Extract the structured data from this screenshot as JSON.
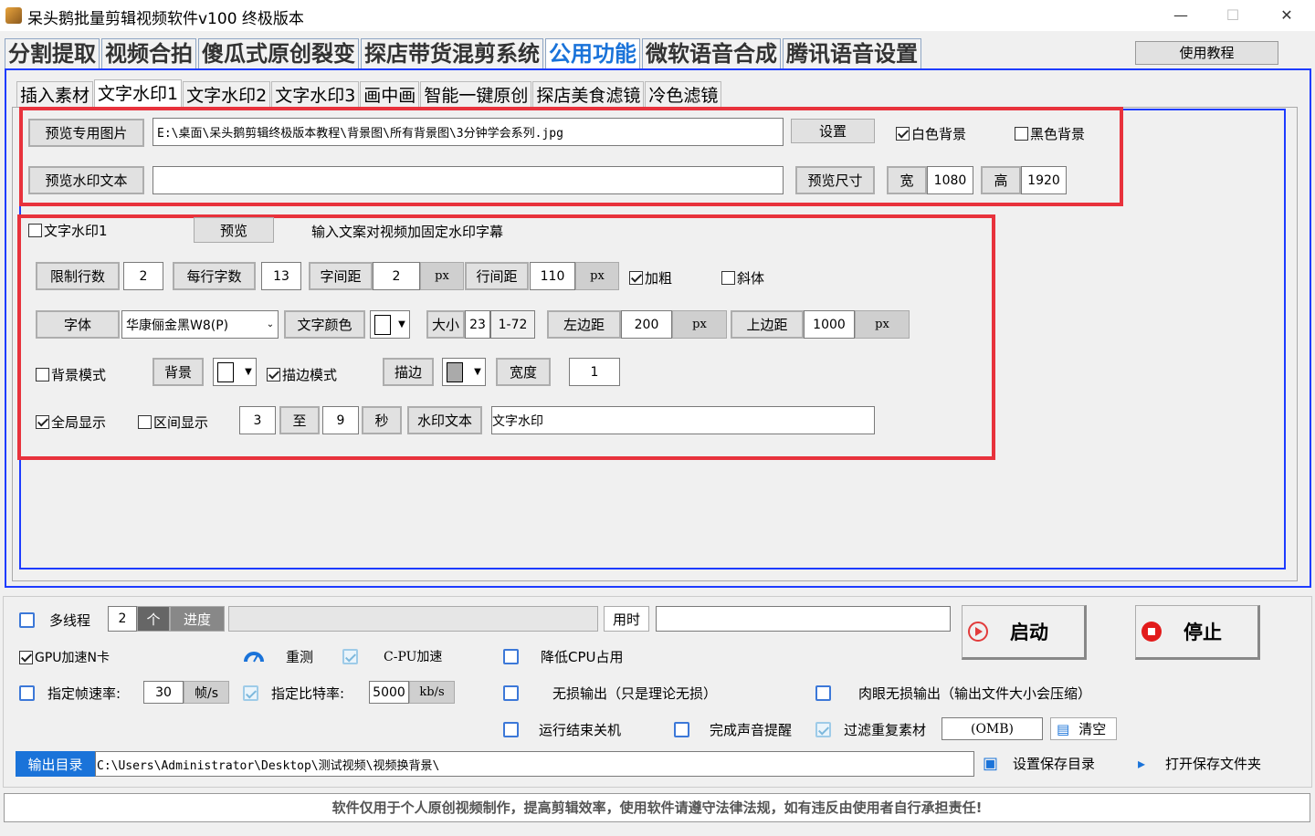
{
  "window": {
    "title": "呆头鹅批量剪辑视频软件v100 终极版本",
    "minimize": "—",
    "maximize": "☐",
    "close": "✕"
  },
  "main_tabs": [
    "分割提取",
    "视频合拍",
    "傻瓜式原创裂变",
    "探店带货混剪系统",
    "公用功能",
    "微软语音合成",
    "腾讯语音设置"
  ],
  "tutorial_button": "使用教程",
  "sub_tabs": [
    "插入素材",
    "文字水印1",
    "文字水印2",
    "文字水印3",
    "画中画",
    "智能一键原创",
    "探店美食滤镜",
    "冷色滤镜"
  ],
  "preview": {
    "image_button": "预览专用图片",
    "image_path": "E:\\桌面\\呆头鹅剪辑终极版本教程\\背景图\\所有背景图\\3分钟学会系列.jpg",
    "settings_button": "设置",
    "white_bg": "白色背景",
    "black_bg": "黑色背景",
    "watermark_text_button": "预览水印文本",
    "watermark_text_value": "",
    "size_button": "预览尺寸",
    "width_label": "宽",
    "width_value": "1080",
    "height_label": "高",
    "height_value": "1920"
  },
  "watermark": {
    "enable_label": "文字水印1",
    "preview_button": "预览",
    "description": "输入文案对视频加固定水印字幕",
    "limit_lines_label": "限制行数",
    "limit_lines_value": "2",
    "chars_per_line_label": "每行字数",
    "chars_per_line_value": "13",
    "char_spacing_label": "字间距",
    "char_spacing_value": "2",
    "px": "px",
    "line_spacing_label": "行间距",
    "line_spacing_value": "110",
    "bold_label": "加粗",
    "italic_label": "斜体",
    "font_label": "字体",
    "font_value": "华康俪金黑W8(P)",
    "font_color_label": "文字颜色",
    "size_label": "大小",
    "size_value": "23",
    "size_range": "1-72",
    "left_margin_label": "左边距",
    "left_margin_value": "200",
    "top_margin_label": "上边距",
    "top_margin_value": "1000",
    "bg_mode_label": "背景模式",
    "bg_button": "背景",
    "stroke_mode_label": "描边模式",
    "stroke_button": "描边",
    "stroke_width_label": "宽度",
    "stroke_width_value": "1",
    "global_display_label": "全局显示",
    "range_display_label": "区间显示",
    "range_start": "3",
    "range_to": "至",
    "range_end": "9",
    "seconds": "秒",
    "watermark_text_label": "水印文本",
    "watermark_text_value": "文字水印"
  },
  "bottom": {
    "multithread_label": "多线程",
    "threads_value": "2",
    "threads_unit": "个",
    "progress_label": "进度",
    "elapsed_label": "用时",
    "elapsed_value": "",
    "start_button": "启动",
    "stop_button": "停止",
    "gpu_label": "GPU加速N卡",
    "retest_label": "重测",
    "cpu_accel_label": "C-PU加速",
    "reduce_cpu_label": "降低CPU占用",
    "framerate_label": "指定帧速率:",
    "framerate_value": "30",
    "framerate_unit": "帧/s",
    "bitrate_label": "指定比特率:",
    "bitrate_value": "5000",
    "bitrate_unit": "kb/s",
    "lossless_label": "无损输出（只是理论无损）",
    "visual_lossless_label": "肉眼无损输出（输出文件大小会压缩）",
    "shutdown_label": "运行结束关机",
    "sound_label": "完成声音提醒",
    "filter_dup_label": "过滤重复素材",
    "filter_size": "(OMB)",
    "clear_button": "清空",
    "output_dir_label": "输出目录",
    "output_dir_value": "C:\\Users\\Administrator\\Desktop\\测试视频\\视频换背景\\",
    "set_save_dir": "设置保存目录",
    "open_save_dir": "打开保存文件夹"
  },
  "footer": "软件仅用于个人原创视频制作，提高剪辑效率，使用软件请遵守法律法规，如有违反由使用者自行承担责任!",
  "colors": {
    "accent_blue": "#1a73d9",
    "red_highlight": "#e8323c",
    "panel_border_blue": "#1e3cff"
  }
}
